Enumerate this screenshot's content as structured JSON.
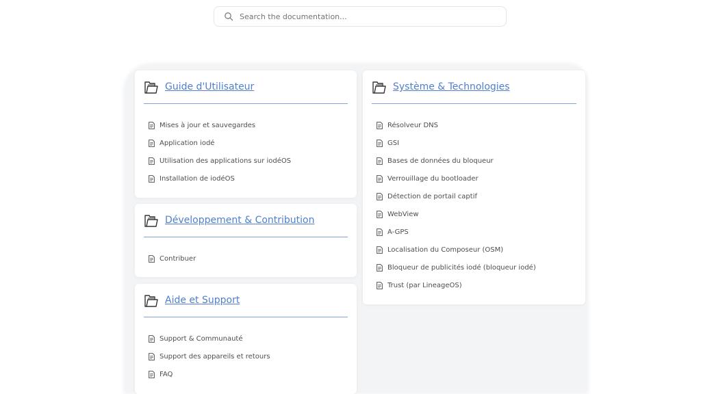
{
  "search": {
    "placeholder": "Search the documentation..."
  },
  "sections": {
    "guide": {
      "title": "Guide d'Utilisateur",
      "links": [
        "Mises à jour et sauvegardes",
        "Application iodé",
        "Utilisation des applications sur iodéOS",
        "Installation de iodéOS"
      ]
    },
    "dev": {
      "title": "Développement & Contribution",
      "links": [
        "Contribuer"
      ]
    },
    "aide": {
      "title": "Aide et Support",
      "links": [
        "Support & Communauté",
        "Support des appareils et retours",
        "FAQ"
      ]
    },
    "sys": {
      "title": "Système & Technologies",
      "links": [
        "Résolveur DNS",
        "GSI",
        "Bases de données du bloqueur",
        "Verrouillage du bootloader",
        "Détection de portail captif",
        "WebView",
        "A-GPS",
        "Localisation du Composeur (OSM)",
        "Bloqueur de publicités iodé (bloqueur iodé)",
        "Trust (par LineageOS)"
      ]
    }
  },
  "colors": {
    "accent": "#4f7fce",
    "divider": "#7fa2df",
    "background": "#f3f4f6"
  },
  "icons": {
    "search": "search-icon",
    "section": "folder-icon",
    "link": "document-icon"
  }
}
